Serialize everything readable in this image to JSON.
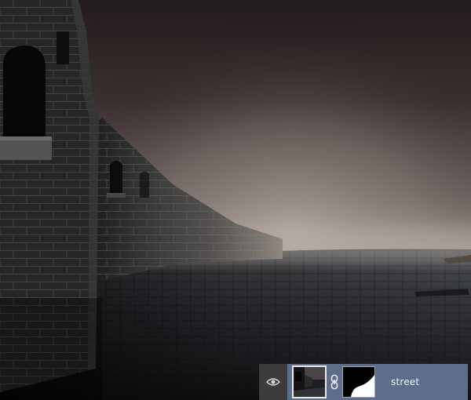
{
  "canvas": {
    "scene": "foggy-castle-street"
  },
  "layers_panel": {
    "layer": {
      "name": "street",
      "visible": true,
      "has_mask": true,
      "linked": true
    },
    "icons": {
      "visibility": "eye-icon",
      "link": "chain-link-icon"
    },
    "colors": {
      "row_selected": "#5d6e8b",
      "eye_cell": "#3c3c3c",
      "name_text": "#f3f5f9"
    }
  }
}
